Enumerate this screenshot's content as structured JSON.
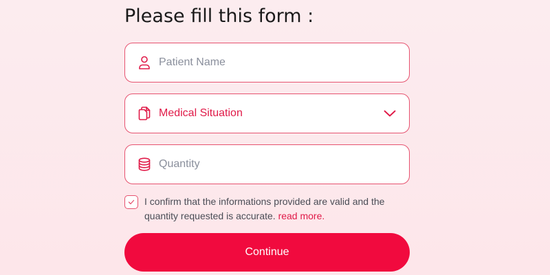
{
  "form": {
    "title": "Please fill this form :",
    "patient_name": {
      "icon": "user-icon",
      "placeholder": "Patient Name",
      "value": ""
    },
    "medical_situation": {
      "icon": "documents-icon",
      "selected": "Medical Situation",
      "arrow_icon": "chevron-down-icon"
    },
    "quantity": {
      "icon": "coins-stack-icon",
      "placeholder": "Quantity",
      "value": ""
    },
    "confirm": {
      "checked": true,
      "text": "I confirm that the informations provided are valid and the quantity requested is accurate.",
      "link_text": "read more."
    },
    "continue_label": "Continue"
  },
  "colors": {
    "accent": "#f10a3e",
    "accent_text": "#e01a48",
    "border": "#e6526f",
    "title": "#1a1a1a",
    "body_text": "#4a4d56",
    "placeholder": "#8a8f9c",
    "background": "#fcecef"
  }
}
